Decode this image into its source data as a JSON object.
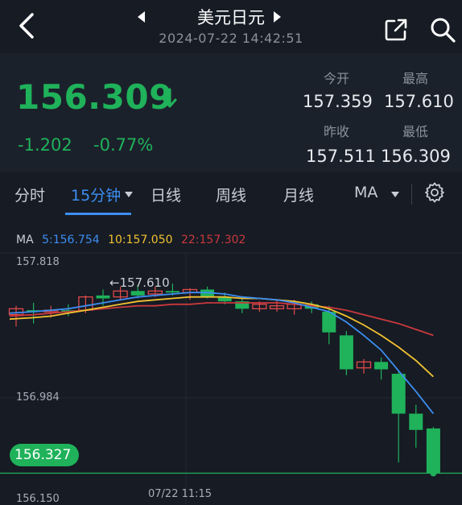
{
  "header": {
    "title": "美元日元",
    "timestamp": "2024-07-22 14:42:51"
  },
  "quote": {
    "price": "156.309",
    "change": "-1.202",
    "change_pct": "-0.77%",
    "stats": {
      "open_label": "今开",
      "open_value": "157.359",
      "high_label": "最高",
      "high_value": "157.610",
      "prev_close_label": "昨收",
      "prev_close_value": "157.511",
      "low_label": "最低",
      "low_value": "156.309"
    }
  },
  "tabs": [
    {
      "label": "分时"
    },
    {
      "label": "15分钟"
    },
    {
      "label": "日线"
    },
    {
      "label": "周线"
    },
    {
      "label": "月线"
    },
    {
      "label": "MA"
    }
  ],
  "colors": {
    "up": "#e04a4a",
    "down": "#1fb25a",
    "ma5": "#3d8ef0",
    "ma10": "#f2c230",
    "ma22": "#c9393d",
    "accent": "#3d8ef0"
  },
  "chart_data": {
    "type": "candlestick",
    "legend": {
      "ma_label": "MA",
      "ma5": "5:156.754",
      "ma10": "10:157.050",
      "ma22": "22:157.302"
    },
    "y_ticks": [
      "157.818",
      "156.984",
      "156.150"
    ],
    "ylim": [
      156.15,
      157.818
    ],
    "x_tick": "07/22 11:15",
    "current_price_label": "156.327",
    "current_price": 156.327,
    "high_annotation": "157.610",
    "candles": [
      {
        "o": 157.4,
        "h": 157.46,
        "l": 157.32,
        "c": 157.44
      },
      {
        "o": 157.43,
        "h": 157.48,
        "l": 157.34,
        "c": 157.42
      },
      {
        "o": 157.42,
        "h": 157.46,
        "l": 157.38,
        "c": 157.43
      },
      {
        "o": 157.43,
        "h": 157.47,
        "l": 157.39,
        "c": 157.42
      },
      {
        "o": 157.43,
        "h": 157.53,
        "l": 157.41,
        "c": 157.52
      },
      {
        "o": 157.53,
        "h": 157.57,
        "l": 157.46,
        "c": 157.51
      },
      {
        "o": 157.52,
        "h": 157.59,
        "l": 157.5,
        "c": 157.56
      },
      {
        "o": 157.56,
        "h": 157.6,
        "l": 157.51,
        "c": 157.53
      },
      {
        "o": 157.54,
        "h": 157.59,
        "l": 157.52,
        "c": 157.56
      },
      {
        "o": 157.56,
        "h": 157.61,
        "l": 157.53,
        "c": 157.55
      },
      {
        "o": 157.55,
        "h": 157.58,
        "l": 157.5,
        "c": 157.57
      },
      {
        "o": 157.57,
        "h": 157.59,
        "l": 157.51,
        "c": 157.52
      },
      {
        "o": 157.52,
        "h": 157.55,
        "l": 157.47,
        "c": 157.49
      },
      {
        "o": 157.49,
        "h": 157.52,
        "l": 157.41,
        "c": 157.44
      },
      {
        "o": 157.44,
        "h": 157.49,
        "l": 157.42,
        "c": 157.47
      },
      {
        "o": 157.44,
        "h": 157.5,
        "l": 157.42,
        "c": 157.46
      },
      {
        "o": 157.44,
        "h": 157.5,
        "l": 157.4,
        "c": 157.47
      },
      {
        "o": 157.47,
        "h": 157.49,
        "l": 157.41,
        "c": 157.44
      },
      {
        "o": 157.42,
        "h": 157.46,
        "l": 157.2,
        "c": 157.28
      },
      {
        "o": 157.26,
        "h": 157.29,
        "l": 156.99,
        "c": 157.03
      },
      {
        "o": 157.04,
        "h": 157.1,
        "l": 157.0,
        "c": 157.08
      },
      {
        "o": 157.08,
        "h": 157.11,
        "l": 156.96,
        "c": 157.03
      },
      {
        "o": 157.0,
        "h": 157.02,
        "l": 156.4,
        "c": 156.73
      },
      {
        "o": 156.73,
        "h": 156.79,
        "l": 156.5,
        "c": 156.62
      },
      {
        "o": 156.63,
        "h": 156.64,
        "l": 156.31,
        "c": 156.33
      }
    ],
    "ma5": [
      157.41,
      157.42,
      157.43,
      157.44,
      157.46,
      157.48,
      157.5,
      157.52,
      157.53,
      157.54,
      157.55,
      157.55,
      157.54,
      157.52,
      157.51,
      157.5,
      157.48,
      157.45,
      157.42,
      157.35,
      157.26,
      157.16,
      157.02,
      156.88,
      156.73
    ],
    "ma10": [
      157.37,
      157.38,
      157.39,
      157.41,
      157.43,
      157.45,
      157.47,
      157.49,
      157.5,
      157.51,
      157.52,
      157.52,
      157.52,
      157.51,
      157.51,
      157.5,
      157.49,
      157.47,
      157.44,
      157.39,
      157.33,
      157.26,
      157.18,
      157.09,
      156.98
    ],
    "ma22": [
      157.39,
      157.4,
      157.41,
      157.42,
      157.43,
      157.44,
      157.45,
      157.46,
      157.46,
      157.47,
      157.47,
      157.48,
      157.48,
      157.48,
      157.48,
      157.48,
      157.47,
      157.46,
      157.45,
      157.43,
      157.4,
      157.37,
      157.34,
      157.3,
      157.26
    ]
  }
}
